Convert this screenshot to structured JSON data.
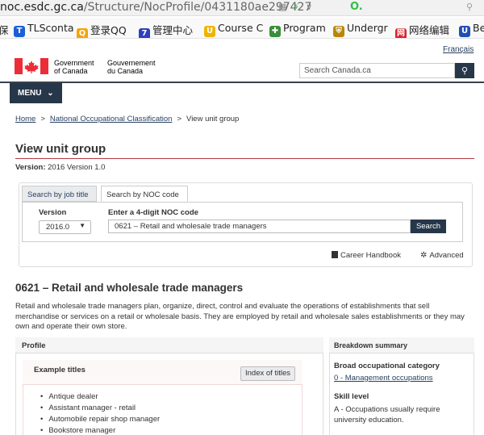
{
  "browser": {
    "url_domain": "noc.esdc.gc.ca",
    "url_path": "/Structure/NocProfile/0431180ae297427",
    "bookmarks": [
      {
        "label": "保",
        "icon": "",
        "color": "#ffffff"
      },
      {
        "label": "TLSconta",
        "icon": "T",
        "color": "#1a5fd6"
      },
      {
        "label": "登录QQ",
        "icon": "Q",
        "color": "#f5a300"
      },
      {
        "label": "管理中心",
        "icon": "7",
        "color": "#2f3fbf"
      },
      {
        "label": "Course C",
        "icon": "U",
        "color": "#f0b400"
      },
      {
        "label": "Program",
        "icon": "✚",
        "color": "#3b8c3b"
      },
      {
        "label": "Undergr",
        "icon": "⛨",
        "color": "#b8860b"
      },
      {
        "label": "网络编辑",
        "icon": "网",
        "color": "#d9232d"
      },
      {
        "label": "Be",
        "icon": "U",
        "color": "#2050b0"
      }
    ]
  },
  "header": {
    "language_link": "Français",
    "gov_en_1": "Government",
    "gov_en_2": "of Canada",
    "gov_fr_1": "Gouvernement",
    "gov_fr_2": "du Canada",
    "search_placeholder": "Search Canada.ca",
    "menu_label": "MENU"
  },
  "breadcrumb": {
    "home": "Home",
    "noc": "National Occupational Classification",
    "current": "View unit group"
  },
  "page": {
    "title": "View unit group",
    "version_label": "Version:",
    "version_value": "2016 Version 1.0"
  },
  "search_panel": {
    "tab_job_title": "Search by job title",
    "tab_noc_code": "Search by NOC code",
    "version_label": "Version",
    "version_selected": "2016.0",
    "noc_label": "Enter a 4-digit NOC code",
    "noc_value": "0621 – Retail and wholesale trade managers",
    "search_button": "Search",
    "career_handbook": "Career Handbook",
    "advanced": "Advanced"
  },
  "unit_group": {
    "title": "0621 – Retail and wholesale trade managers",
    "description": "Retail and wholesale trade managers plan, organize, direct, control and evaluate the operations of establishments that sell merchandise or services on a retail or wholesale basis. They are employed by retail and wholesale sales establishments or they may own and operate their own store."
  },
  "profile": {
    "heading": "Profile",
    "example_titles_heading": "Example titles",
    "index_button": "Index of titles",
    "example_titles": [
      "Antique dealer",
      "Assistant manager - retail",
      "Automobile repair shop manager",
      "Bookstore manager"
    ]
  },
  "breakdown": {
    "heading": "Breakdown summary",
    "boc_label": "Broad occupational category",
    "boc_value": "0 - Management occupations",
    "skill_label": "Skill level",
    "skill_value": "A - Occupations usually require university education."
  },
  "colors": {
    "navy": "#26374a",
    "link": "#284162",
    "title_rule": "#af3c43",
    "flag_red": "#eb2d37"
  }
}
